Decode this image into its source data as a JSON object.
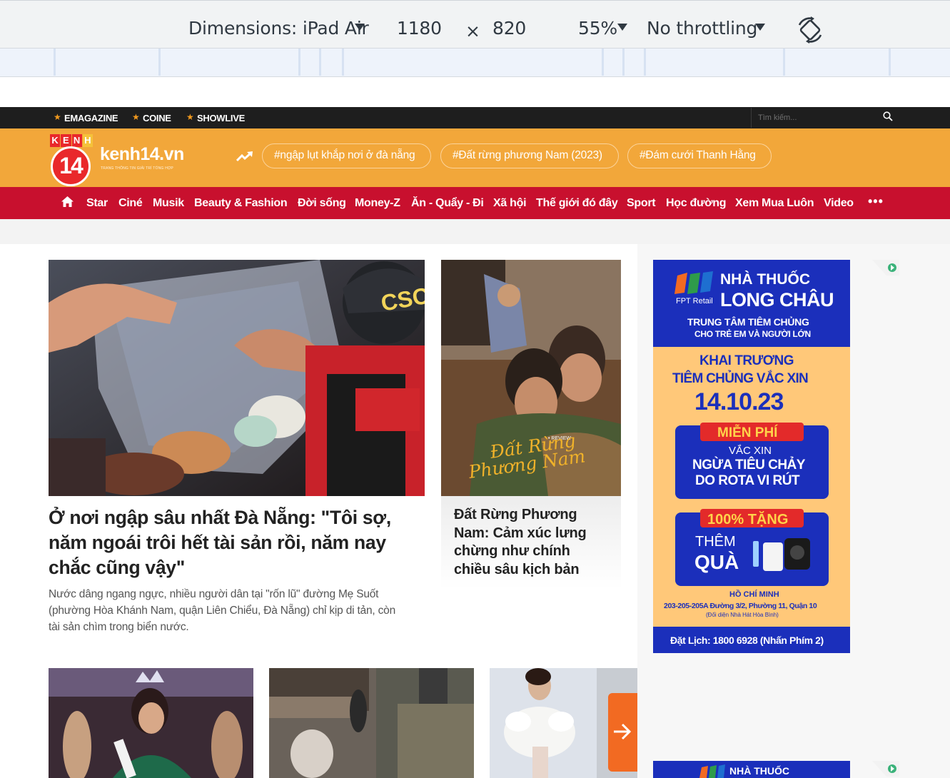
{
  "devtools": {
    "dimensions_label": "Dimensions: iPad Air",
    "width": "1180",
    "times": "×",
    "height": "820",
    "zoom": "55%",
    "throttling": "No throttling"
  },
  "topbar": {
    "links": [
      "EMAGAZINE",
      "COINE",
      "SHOWLIVE"
    ],
    "search_placeholder": "Tìm kiếm..."
  },
  "header": {
    "logo_badge_top": "KENH",
    "logo_badge_num": "14",
    "logo_text": "kenh14.vn",
    "logo_tagline": "TRANG THÔNG TIN GIẢI TRÍ TỔNG HỢP",
    "trending": [
      "#ngập lụt khắp nơi ở đà nẵng",
      "#Đất rừng phương Nam (2023)",
      "#Đám cưới Thanh Hằng"
    ]
  },
  "nav": {
    "items": [
      "Star",
      "Ciné",
      "Musik",
      "Beauty & Fashion",
      "Đời sống",
      "Money-Z",
      "Ăn - Quẩy - Đi",
      "Xã hội",
      "Thế giới đó đây",
      "Sport",
      "Học đường",
      "Xem Mua Luôn",
      "Video"
    ],
    "more": "•••"
  },
  "main_story": {
    "headline_lines": [
      "Ở nơi ngập sâu nhất Đà Nẵng: \"Tôi sợ,",
      "năm ngoái trôi hết tài sản rồi, năm nay",
      "chắc cũng vậy\""
    ],
    "sapo_lines": [
      "Nước dâng ngang ngực, nhiều người dân tại \"rốn lũ\" đường Mẹ Suốt",
      "(phường Hòa Khánh Nam, quận Liên Chiểu, Đà Nẵng) chỉ kịp di tản, còn",
      "tài sản chìm trong biển nước."
    ],
    "photo_text": "CSCĐ"
  },
  "second_story": {
    "headline_lines": [
      "Đất Rừng Phương",
      "Nam: Cảm xúc lưng",
      "chừng như chính",
      "chiều sâu kịch bản"
    ],
    "photo_review": "• REVIEW",
    "photo_title_1": "Đất Rừng",
    "photo_title_2": "Phương Nam"
  },
  "ad": {
    "brand_1": "NHÀ THUỐC",
    "brand_2": "LONG CHÂU",
    "fpt": "FPT Retail",
    "center_1": "TRUNG TÂM TIÊM CHỦNG",
    "center_2": "CHO TRẺ EM VÀ NGƯỜI LỚN",
    "open_1": "KHAI TRƯƠNG",
    "open_2": "TIÊM CHỦNG VẮC XIN",
    "date": "14.10.23",
    "free": "MIỄN PHÍ",
    "vaccine_1": "VẮC XIN",
    "vaccine_2": "NGỪA TIÊU CHẢY",
    "vaccine_3": "DO ROTA VI RÚT",
    "gift": "100% TẶNG",
    "gift_1": "THÊM",
    "gift_2": "QUÀ",
    "city": "HỒ CHÍ MINH",
    "address": "203-205-205A Đường 3/2, Phường 11, Quận 10",
    "address_note": "(Đối diện Nhà Hát Hòa Bình)",
    "booking": "Đặt Lịch: 1800 6928 (Nhấn Phím 2)",
    "brand_bottom": "NHÀ THUỐC"
  },
  "colors": {
    "orange": "#f2a73a",
    "red": "#c8102e",
    "dark": "#1e1e1e",
    "ad_blue": "#1b2fbb"
  }
}
